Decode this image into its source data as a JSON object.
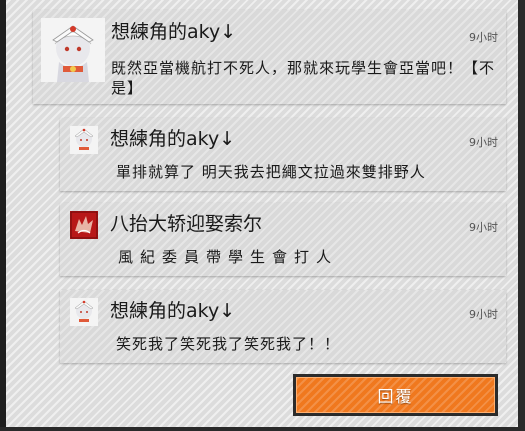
{
  "post": {
    "author": "想練角的aky↓",
    "time": "9小时",
    "text": "既然亞當機航打不死人，那就來玩學生會亞當吧！【不是】",
    "avatar_icon": "anime-avatar-icon"
  },
  "replies": [
    {
      "author": "想練角的aky↓",
      "time": "9小时",
      "text": "單排就算了 明天我去把繩文拉過來雙排野人",
      "avatar_icon": "anime-avatar-icon"
    },
    {
      "author": "八抬大轿迎娶索尔",
      "time": "9小时",
      "text": "風紀委員帶學生會打人",
      "avatar_icon": "red-emblem-avatar-icon"
    },
    {
      "author": "想練角的aky↓",
      "time": "9小时",
      "text": "笑死我了笑死我了笑死我了！！",
      "avatar_icon": "anime-avatar-icon"
    }
  ],
  "reply_button": {
    "label": "回覆"
  },
  "colors": {
    "accent": "#f0781e",
    "panel": "#d9d9d9",
    "text": "#1a1a1a"
  }
}
